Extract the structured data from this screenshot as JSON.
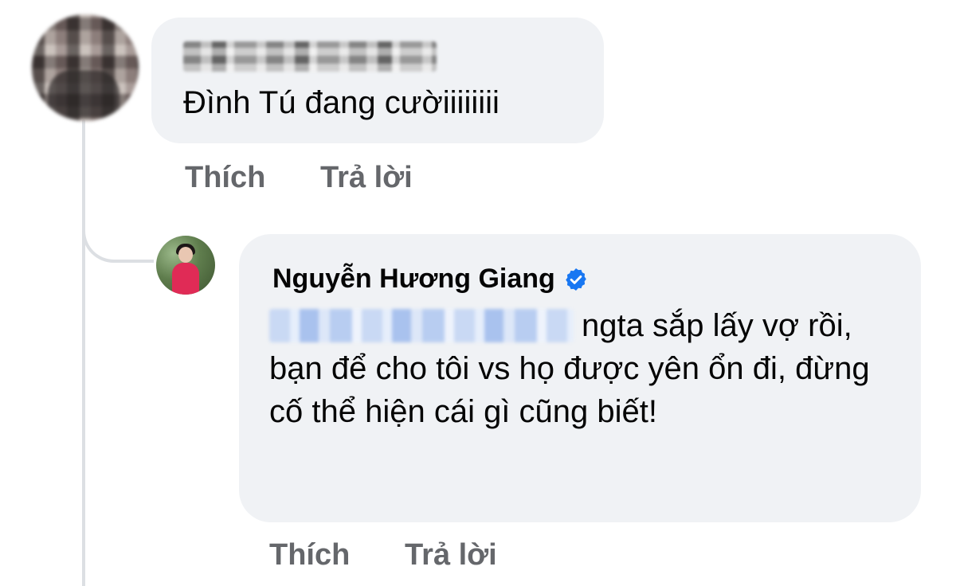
{
  "comments": [
    {
      "author": "",
      "text": "Đình Tú đang cườiiiiiiii",
      "actions": {
        "like": "Thích",
        "reply": "Trả lời"
      }
    },
    {
      "author": "Nguyễn Hương Giang",
      "verified": true,
      "text": "ngta sắp lấy vợ rồi, bạn để cho tôi vs họ được yên ổn đi, đừng cố thể hiện cái gì cũng biết!",
      "actions": {
        "like": "Thích",
        "reply": "Trả lời"
      }
    }
  ],
  "colors": {
    "bubble_bg": "#f0f2f5",
    "action_text": "#65676b",
    "verified_badge": "#1877f2",
    "thread_line": "#dcdfe3"
  },
  "icons": {
    "verified": "verified-badge-icon"
  }
}
